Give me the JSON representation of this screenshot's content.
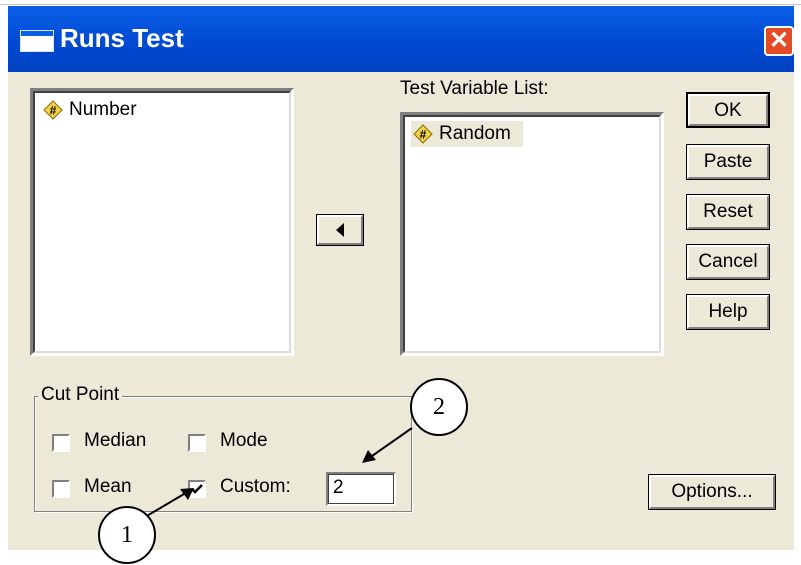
{
  "window": {
    "title": "Runs Test",
    "close_glyph": "✕"
  },
  "source_list": {
    "items": [
      {
        "label": "Number",
        "icon": "scale-variable-icon"
      }
    ]
  },
  "target_list": {
    "label": "Test Variable List:",
    "items": [
      {
        "label": "Random",
        "icon": "scale-variable-icon",
        "selected": true
      }
    ]
  },
  "move_button": {
    "icon": "left-arrow-icon"
  },
  "buttons": {
    "ok": "OK",
    "paste": "Paste",
    "reset": "Reset",
    "cancel": "Cancel",
    "help": "Help",
    "options": "Options..."
  },
  "cut_point": {
    "label": "Cut Point",
    "median": {
      "label": "Median",
      "checked": false
    },
    "mode": {
      "label": "Mode",
      "checked": false
    },
    "mean": {
      "label": "Mean",
      "checked": false
    },
    "custom": {
      "label": "Custom:",
      "checked": true,
      "value": "2"
    }
  },
  "callouts": {
    "one": "1",
    "two": "2"
  },
  "colors": {
    "titlebar": "#0a5fe6",
    "dialog_bg": "#ece9d8",
    "close_button": "#e34a26",
    "selection_bg": "#ece9d8"
  }
}
